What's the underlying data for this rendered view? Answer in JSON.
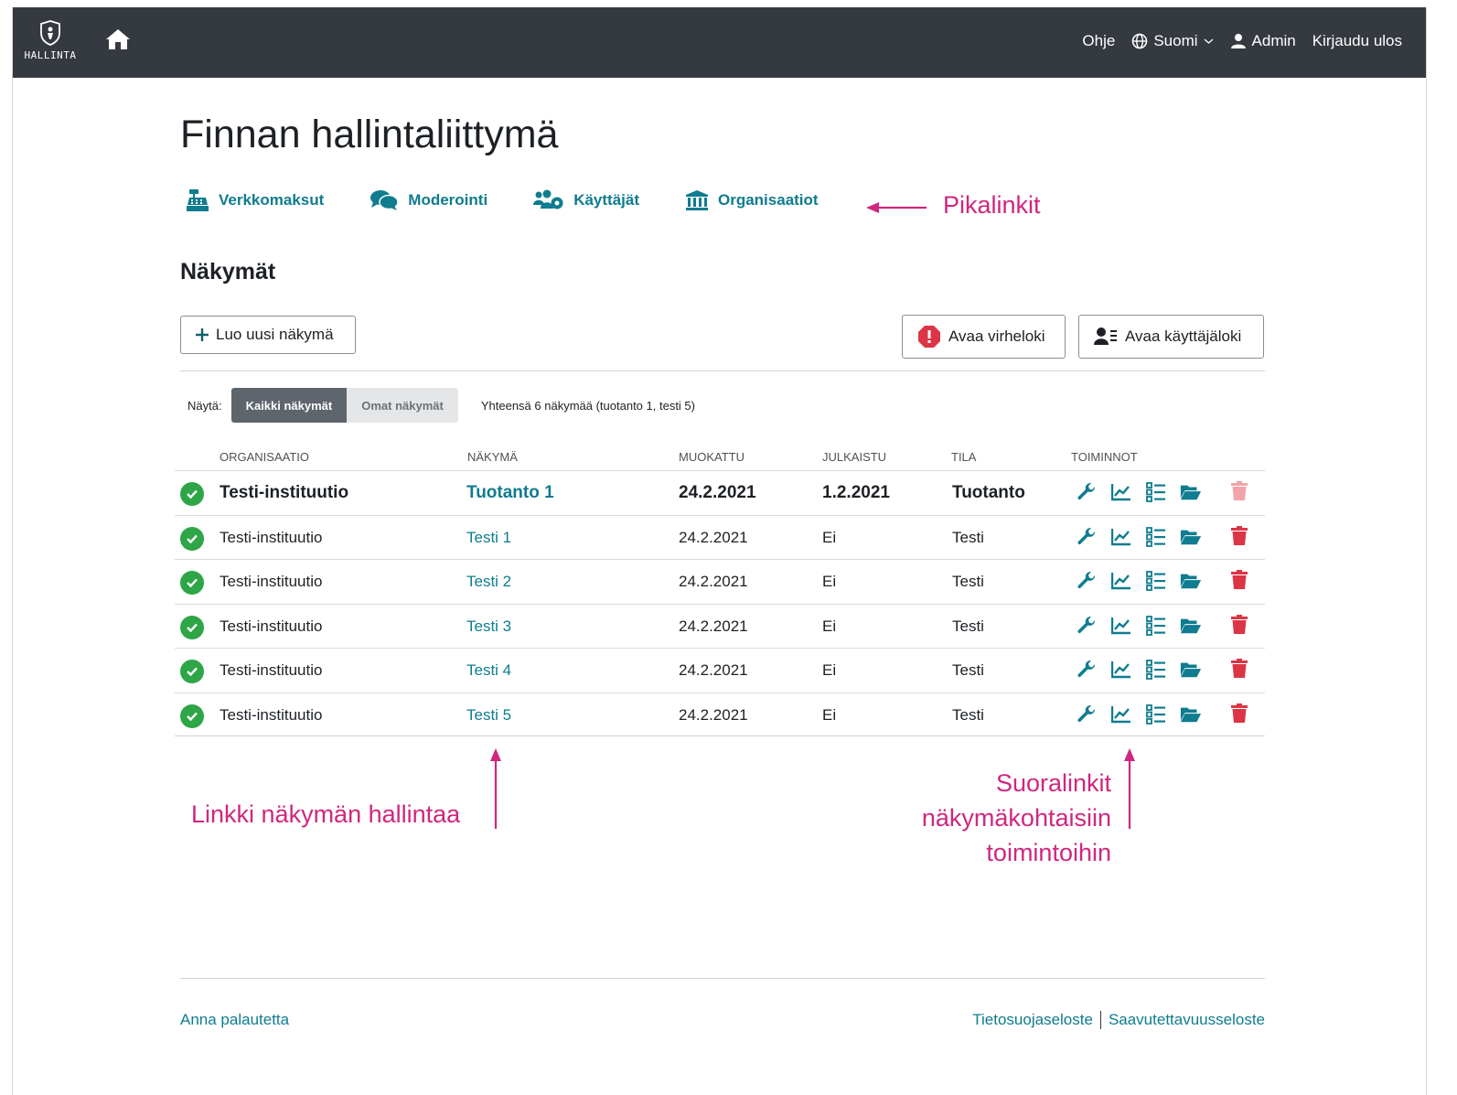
{
  "topbar": {
    "logo_text": "HALLINTA",
    "help": "Ohje",
    "language": "Suomi",
    "user": "Admin",
    "logout": "Kirjaudu ulos"
  },
  "page": {
    "title": "Finnan hallintaliittymä"
  },
  "quicklinks": [
    {
      "label": "Verkkomaksut",
      "icon": "cash-register-icon"
    },
    {
      "label": "Moderointi",
      "icon": "comments-icon"
    },
    {
      "label": "Käyttäjät",
      "icon": "users-cog-icon"
    },
    {
      "label": "Organisaatiot",
      "icon": "landmark-icon"
    }
  ],
  "annotations": {
    "quicklinks": "Pikalinkit",
    "view_link": "Linkki näkymän hallintaa",
    "direct_links_1": "Suoralinkit",
    "direct_links_2": "näkymäkohtaisiin",
    "direct_links_3": "toimintoihin"
  },
  "views": {
    "heading": "Näkymät",
    "create_button": "Luo uusi näkymä",
    "error_log_button": "Avaa virheloki",
    "user_log_button": "Avaa käyttäjäloki",
    "filter_label": "Näytä:",
    "filter_all": "Kaikki näkymät",
    "filter_own": "Omat näkymät",
    "total": "Yhteensä 6 näkymää (tuotanto 1, testi 5)"
  },
  "table": {
    "headers": [
      "ORGANISAATIO",
      "NÄKYMÄ",
      "MUOKATTU",
      "JULKAISTU",
      "TILA",
      "TOIMINNOT"
    ],
    "rows": [
      {
        "org": "Testi-instituutio",
        "view": "Tuotanto 1",
        "modified": "24.2.2021",
        "published": "1.2.2021",
        "state": "Tuotanto",
        "bold": true
      },
      {
        "org": "Testi-instituutio",
        "view": "Testi 1",
        "modified": "24.2.2021",
        "published": "Ei",
        "state": "Testi"
      },
      {
        "org": "Testi-instituutio",
        "view": "Testi 2",
        "modified": "24.2.2021",
        "published": "Ei",
        "state": "Testi"
      },
      {
        "org": "Testi-instituutio",
        "view": "Testi 3",
        "modified": "24.2.2021",
        "published": "Ei",
        "state": "Testi"
      },
      {
        "org": "Testi-instituutio",
        "view": "Testi 4",
        "modified": "24.2.2021",
        "published": "Ei",
        "state": "Testi"
      },
      {
        "org": "Testi-instituutio",
        "view": "Testi 5",
        "modified": "24.2.2021",
        "published": "Ei",
        "state": "Testi"
      }
    ]
  },
  "footer": {
    "feedback": "Anna palautetta",
    "privacy": "Tietosuojaseloste",
    "accessibility": "Saavutettavuusseloste"
  },
  "colors": {
    "topbar": "#343a40",
    "link": "#0f7c8f",
    "success": "#2ea546",
    "danger": "#dc3545",
    "annotation": "#d0267f"
  }
}
